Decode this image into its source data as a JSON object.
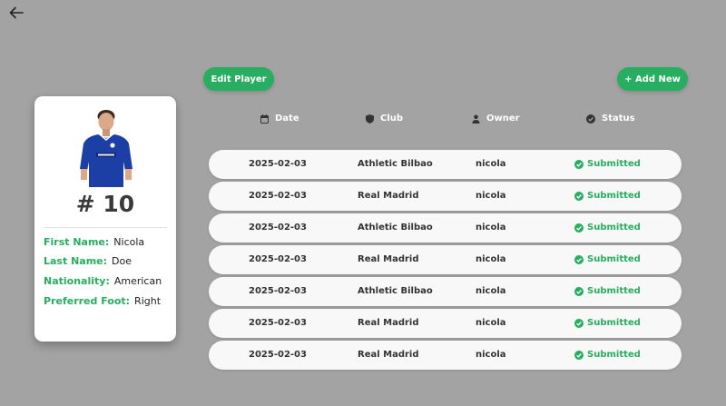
{
  "nav": {
    "back_icon": "arrow-left-icon"
  },
  "toolbar": {
    "edit_label": "Edit Player",
    "add_label": "+ Add New"
  },
  "player": {
    "number": "# 10",
    "first_name_label": "First Name:",
    "first_name": "Nicola",
    "last_name_label": "Last Name:",
    "last_name": "Doe",
    "nationality_label": "Nationality:",
    "nationality": "American",
    "foot_label": "Preferred Foot:",
    "foot": "Right"
  },
  "table": {
    "headers": {
      "date": "Date",
      "club": "Club",
      "owner": "Owner",
      "status": "Status"
    },
    "rows": [
      {
        "date": "2025-02-03",
        "club": "Athletic Bilbao",
        "owner": "nicola",
        "status": "Submitted"
      },
      {
        "date": "2025-02-03",
        "club": "Real Madrid",
        "owner": "nicola",
        "status": "Submitted"
      },
      {
        "date": "2025-02-03",
        "club": "Athletic Bilbao",
        "owner": "nicola",
        "status": "Submitted"
      },
      {
        "date": "2025-02-03",
        "club": "Real Madrid",
        "owner": "nicola",
        "status": "Submitted"
      },
      {
        "date": "2025-02-03",
        "club": "Athletic Bilbao",
        "owner": "nicola",
        "status": "Submitted"
      },
      {
        "date": "2025-02-03",
        "club": "Real Madrid",
        "owner": "nicola",
        "status": "Submitted"
      },
      {
        "date": "2025-02-03",
        "club": "Real Madrid",
        "owner": "nicola",
        "status": "Submitted"
      }
    ]
  },
  "colors": {
    "background": "#a3a3a3",
    "accent": "#27ae60",
    "row_bg": "#f8f8f8",
    "card_bg": "#ffffff"
  }
}
